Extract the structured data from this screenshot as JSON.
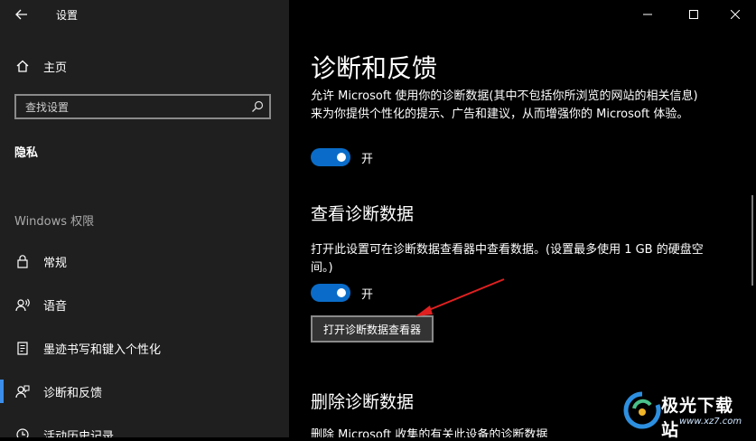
{
  "window": {
    "title": "设置",
    "controls": {
      "minimize": "minimize-icon",
      "maximize": "maximize-icon",
      "close": "close-icon"
    }
  },
  "sidebar": {
    "home_label": "主页",
    "search_placeholder": "查找设置",
    "section_title": "隐私",
    "group_header": "Windows 权限",
    "items": [
      {
        "label": "常规",
        "icon": "lock-icon"
      },
      {
        "label": "语音",
        "icon": "speech-icon"
      },
      {
        "label": "墨迹书写和键入个性化",
        "icon": "pen-document-icon"
      },
      {
        "label": "诊断和反馈",
        "icon": "feedback-icon",
        "selected": true
      },
      {
        "label": "活动历史记录",
        "icon": "history-icon"
      }
    ]
  },
  "main": {
    "heading": "诊断和反馈",
    "desc1": "允许 Microsoft 使用你的诊断数据(其中不包括你所浏览的网站的相关信息)来为你提供个性化的提示、广告和建议，从而增强你的 Microsoft 体验。",
    "toggle1_label": "开",
    "section2_title": "查看诊断数据",
    "desc2": "打开此设置可在诊断数据查看器中查看数据。(设置最多使用 1 GB 的硬盘空间。)",
    "toggle2_label": "开",
    "open_viewer_button": "打开诊断数据查看器",
    "section3_title": "删除诊断数据",
    "desc3": "删除 Microsoft 收集的有关此设备的诊断数据"
  },
  "watermark": {
    "name": "极光下载站",
    "url": "www.xz7.com"
  },
  "colors": {
    "accent": "#0a6cc8",
    "sidebar_bg": "#1f1f1f",
    "main_bg": "#000000",
    "annotation": "#e02020"
  }
}
